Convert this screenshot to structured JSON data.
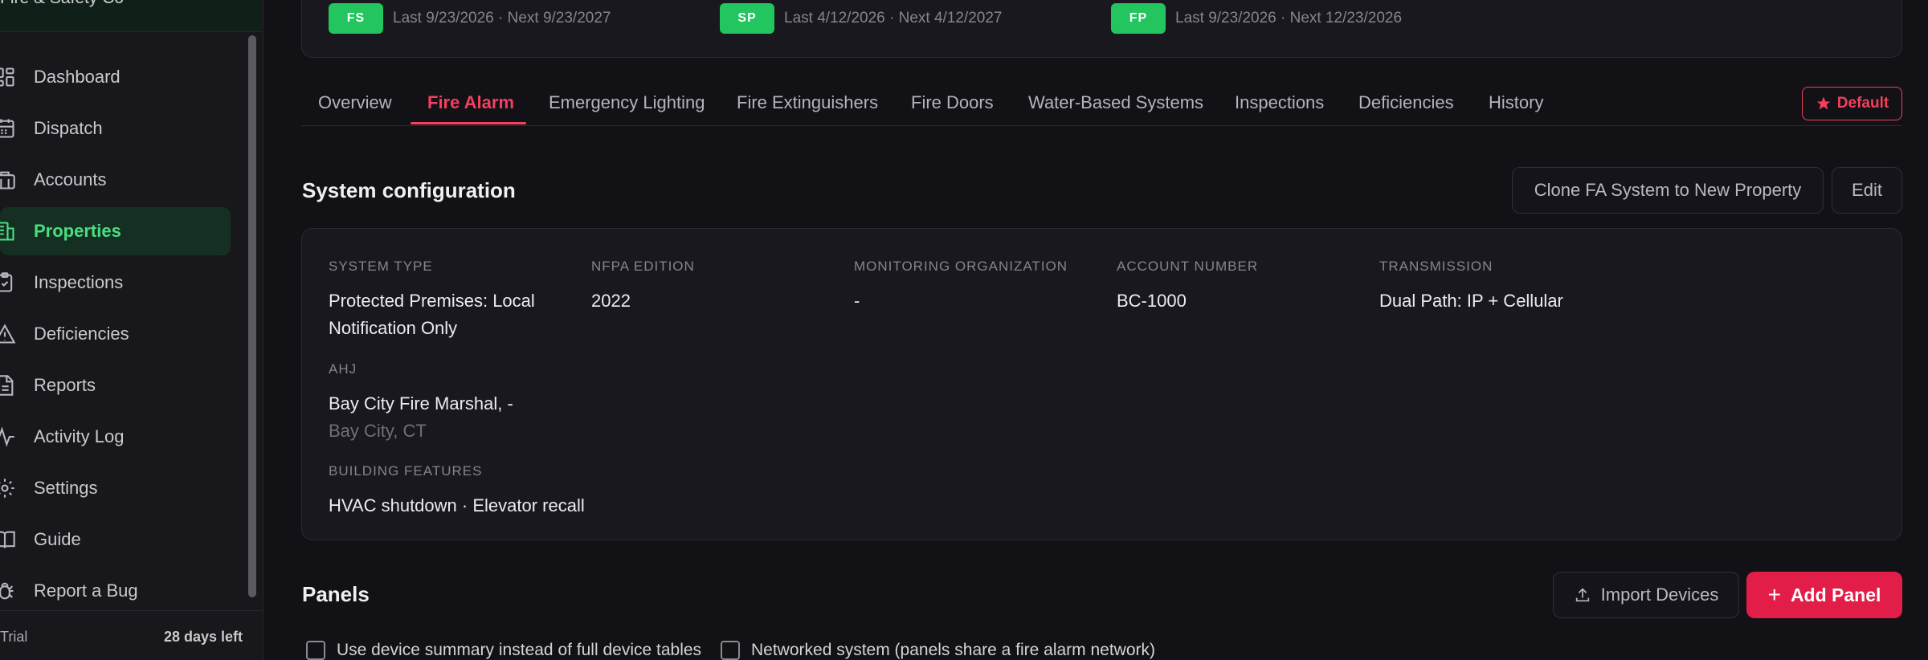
{
  "sidebar": {
    "brand": "Fire & Safety Co",
    "items": [
      {
        "label": "Dashboard",
        "icon": "dashboard-icon"
      },
      {
        "label": "Dispatch",
        "icon": "calendar-icon"
      },
      {
        "label": "Accounts",
        "icon": "building-icon"
      },
      {
        "label": "Properties",
        "icon": "properties-icon",
        "active": true
      },
      {
        "label": "Inspections",
        "icon": "clipboard-check-icon"
      },
      {
        "label": "Deficiencies",
        "icon": "warning-icon"
      },
      {
        "label": "Reports",
        "icon": "document-icon"
      },
      {
        "label": "Activity Log",
        "icon": "activity-icon"
      },
      {
        "label": "Settings",
        "icon": "gear-icon"
      },
      {
        "label": "Guide",
        "icon": "book-icon"
      },
      {
        "label": "Report a Bug",
        "icon": "bug-icon"
      }
    ],
    "footer": {
      "trial": "Trial",
      "days_left": "28 days left"
    }
  },
  "certs": [
    {
      "badge": "FS",
      "dates": "Last 9/23/2026 · Next 9/23/2027"
    },
    {
      "badge": "SP",
      "dates": "Last 4/12/2026 · Next 4/12/2027"
    },
    {
      "badge": "FP",
      "dates": "Last 9/23/2026 · Next 12/23/2026"
    }
  ],
  "tabs": [
    {
      "label": "Overview"
    },
    {
      "label": "Fire Alarm",
      "active": true
    },
    {
      "label": "Emergency Lighting"
    },
    {
      "label": "Fire Extinguishers"
    },
    {
      "label": "Fire Doors"
    },
    {
      "label": "Water-Based Systems"
    },
    {
      "label": "Inspections"
    },
    {
      "label": "Deficiencies"
    },
    {
      "label": "History"
    }
  ],
  "default_label": "Default",
  "config": {
    "title": "System configuration",
    "clone_label": "Clone FA System to New Property",
    "edit_label": "Edit",
    "fields": {
      "system_type": {
        "label": "System Type",
        "value": "Protected Premises: Local Notification Only"
      },
      "nfpa_edition": {
        "label": "NFPA Edition",
        "value": "2022"
      },
      "monitoring_org": {
        "label": "Monitoring Organization",
        "value": "-"
      },
      "account_number": {
        "label": "Account Number",
        "value": "BC-1000"
      },
      "transmission": {
        "label": "Transmission",
        "value": "Dual Path: IP + Cellular"
      },
      "ahj": {
        "label": "AHJ",
        "value": "Bay City Fire Marshal, -",
        "sub": "Bay City, CT"
      },
      "building_features": {
        "label": "Building Features",
        "value": "HVAC shutdown · Elevator recall"
      }
    }
  },
  "panels": {
    "title": "Panels",
    "import_label": "Import Devices",
    "add_label": "Add Panel",
    "options": [
      {
        "label": "Use device summary instead of full device tables",
        "checked": false
      },
      {
        "label": "Networked system (panels share a fire alarm network)",
        "checked": false
      }
    ]
  },
  "colors": {
    "accent": "#f43f5e",
    "primary": "#e11d48",
    "success": "#22c55e",
    "active_nav": "#4ade80"
  }
}
